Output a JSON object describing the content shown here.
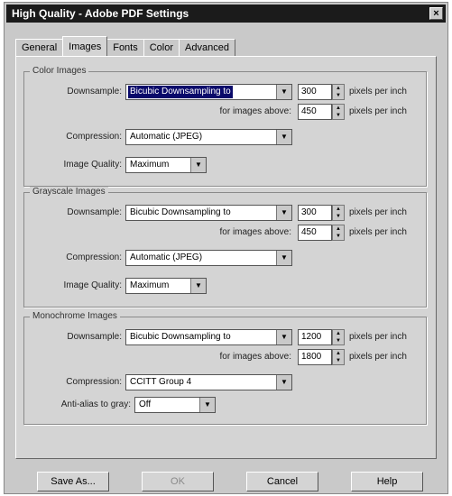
{
  "window": {
    "title": "High Quality - Adobe PDF Settings",
    "close_glyph": "×"
  },
  "tabs": [
    {
      "label": "General"
    },
    {
      "label": "Images"
    },
    {
      "label": "Fonts"
    },
    {
      "label": "Color"
    },
    {
      "label": "Advanced"
    }
  ],
  "icons": {
    "dropdown_arrow": "▼",
    "spin_up": "▲",
    "spin_down": "▼"
  },
  "color": {
    "title": "Color Images",
    "downsample_label": "Downsample:",
    "downsample_value": "Bicubic Downsampling to",
    "ppi_value": "300",
    "ppi_unit": "pixels per inch",
    "above_label": "for images above:",
    "above_value": "450",
    "above_unit": "pixels per inch",
    "compression_label": "Compression:",
    "compression_value": "Automatic (JPEG)",
    "quality_label": "Image Quality:",
    "quality_value": "Maximum"
  },
  "gray": {
    "title": "Grayscale Images",
    "downsample_label": "Downsample:",
    "downsample_value": "Bicubic Downsampling to",
    "ppi_value": "300",
    "ppi_unit": "pixels per inch",
    "above_label": "for images above:",
    "above_value": "450",
    "above_unit": "pixels per inch",
    "compression_label": "Compression:",
    "compression_value": "Automatic (JPEG)",
    "quality_label": "Image Quality:",
    "quality_value": "Maximum"
  },
  "mono": {
    "title": "Monochrome Images",
    "downsample_label": "Downsample:",
    "downsample_value": "Bicubic Downsampling to",
    "ppi_value": "1200",
    "ppi_unit": "pixels per inch",
    "above_label": "for images above:",
    "above_value": "1800",
    "above_unit": "pixels per inch",
    "compression_label": "Compression:",
    "compression_value": "CCITT Group 4",
    "antialias_label": "Anti-alias to gray:",
    "antialias_value": "Off"
  },
  "buttons": {
    "save_as": "Save As...",
    "ok": "OK",
    "cancel": "Cancel",
    "help": "Help"
  }
}
